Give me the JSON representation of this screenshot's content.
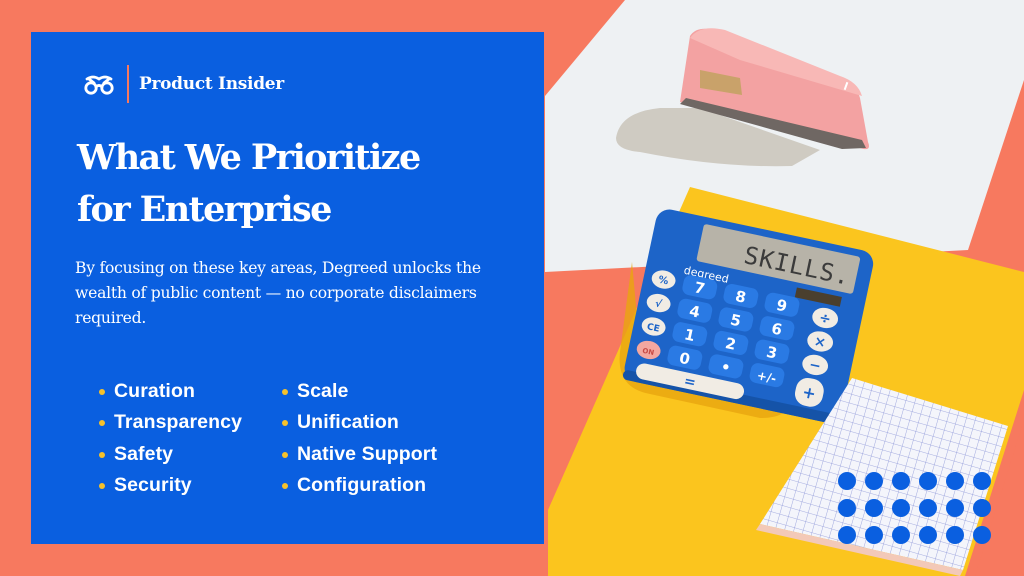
{
  "brand": {
    "logo_icon": "glasses-icon",
    "name": "Product Insider"
  },
  "headline": {
    "line1": "What We Prioritize",
    "line2": "for Enterprise"
  },
  "intro": "By focusing on these key areas, Degreed unlocks the wealth of public content — no corporate disclaimers required.",
  "priorities": {
    "column1": [
      {
        "label": "Curation"
      },
      {
        "label": "Transparency"
      },
      {
        "label": "Safety"
      },
      {
        "label": "Security"
      }
    ],
    "column2": [
      {
        "label": "Scale"
      },
      {
        "label": "Unification"
      },
      {
        "label": "Native Support"
      },
      {
        "label": "Configuration"
      }
    ]
  },
  "photo": {
    "calculator_display": "SKILLS.",
    "calculator_brand": "degreed",
    "calculator_keys": [
      "%",
      "7",
      "8",
      "9",
      "√",
      "4",
      "5",
      "6",
      "÷",
      "CE",
      "1",
      "2",
      "3",
      "×",
      "ON/C",
      "0",
      "•",
      "+/-",
      "−",
      "=",
      "+"
    ],
    "decorative_dots": {
      "rows": 3,
      "columns": 6
    }
  },
  "colors": {
    "background_coral": "#f7795f",
    "panel_blue": "#0a5fe0",
    "bullet_yellow": "#f6c12b",
    "paper_yellow": "#fbc51e",
    "paper_white": "#eef1f3",
    "stapler_pink": "#f4a3a3",
    "calculator_blue": "#1d64c8"
  }
}
